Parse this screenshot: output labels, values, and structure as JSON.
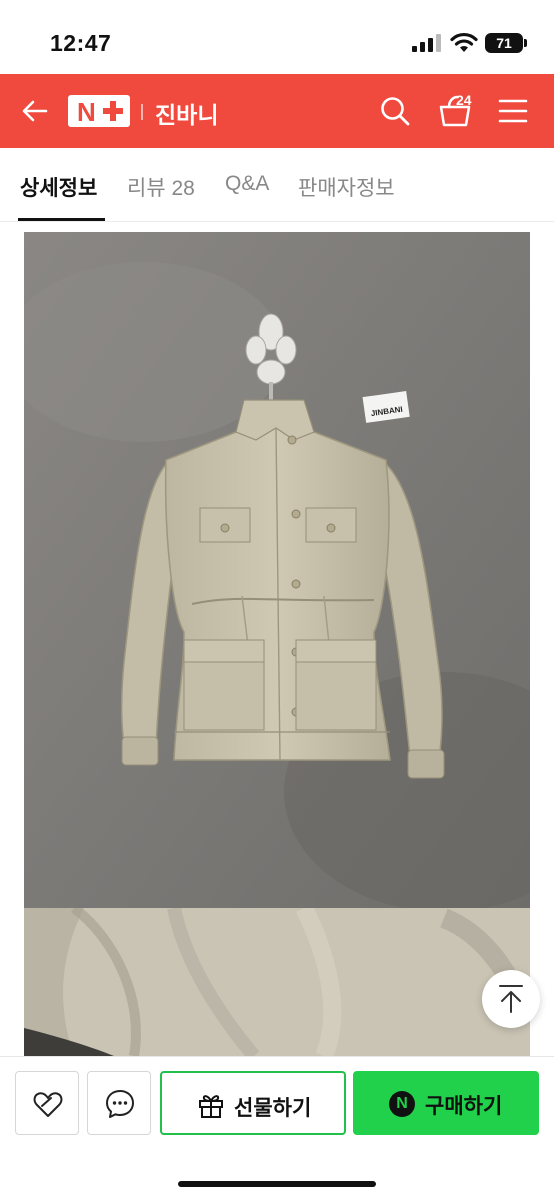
{
  "status_bar": {
    "time": "12:47",
    "battery": "71"
  },
  "header": {
    "logo_letter": "N",
    "store_name": "진바니",
    "cart_count": "24",
    "background_color": "#f0493e",
    "icons": [
      "back-arrow-icon",
      "search-icon",
      "cart-icon",
      "menu-icon"
    ]
  },
  "tabs": [
    {
      "label": "상세정보",
      "active": true
    },
    {
      "label": "리뷰 28",
      "active": false
    },
    {
      "label": "Q&A",
      "active": false
    },
    {
      "label": "판매자정보",
      "active": false
    }
  ],
  "product_image": {
    "hang_tag_text": "JINBANI"
  },
  "bottom_bar": {
    "wishlist_icon": "heart-icon",
    "chat_icon": "chat-bubble-icon",
    "gift_label": "선물하기",
    "buy_badge": "N",
    "buy_label": "구매하기",
    "buy_color": "#21d04b"
  }
}
